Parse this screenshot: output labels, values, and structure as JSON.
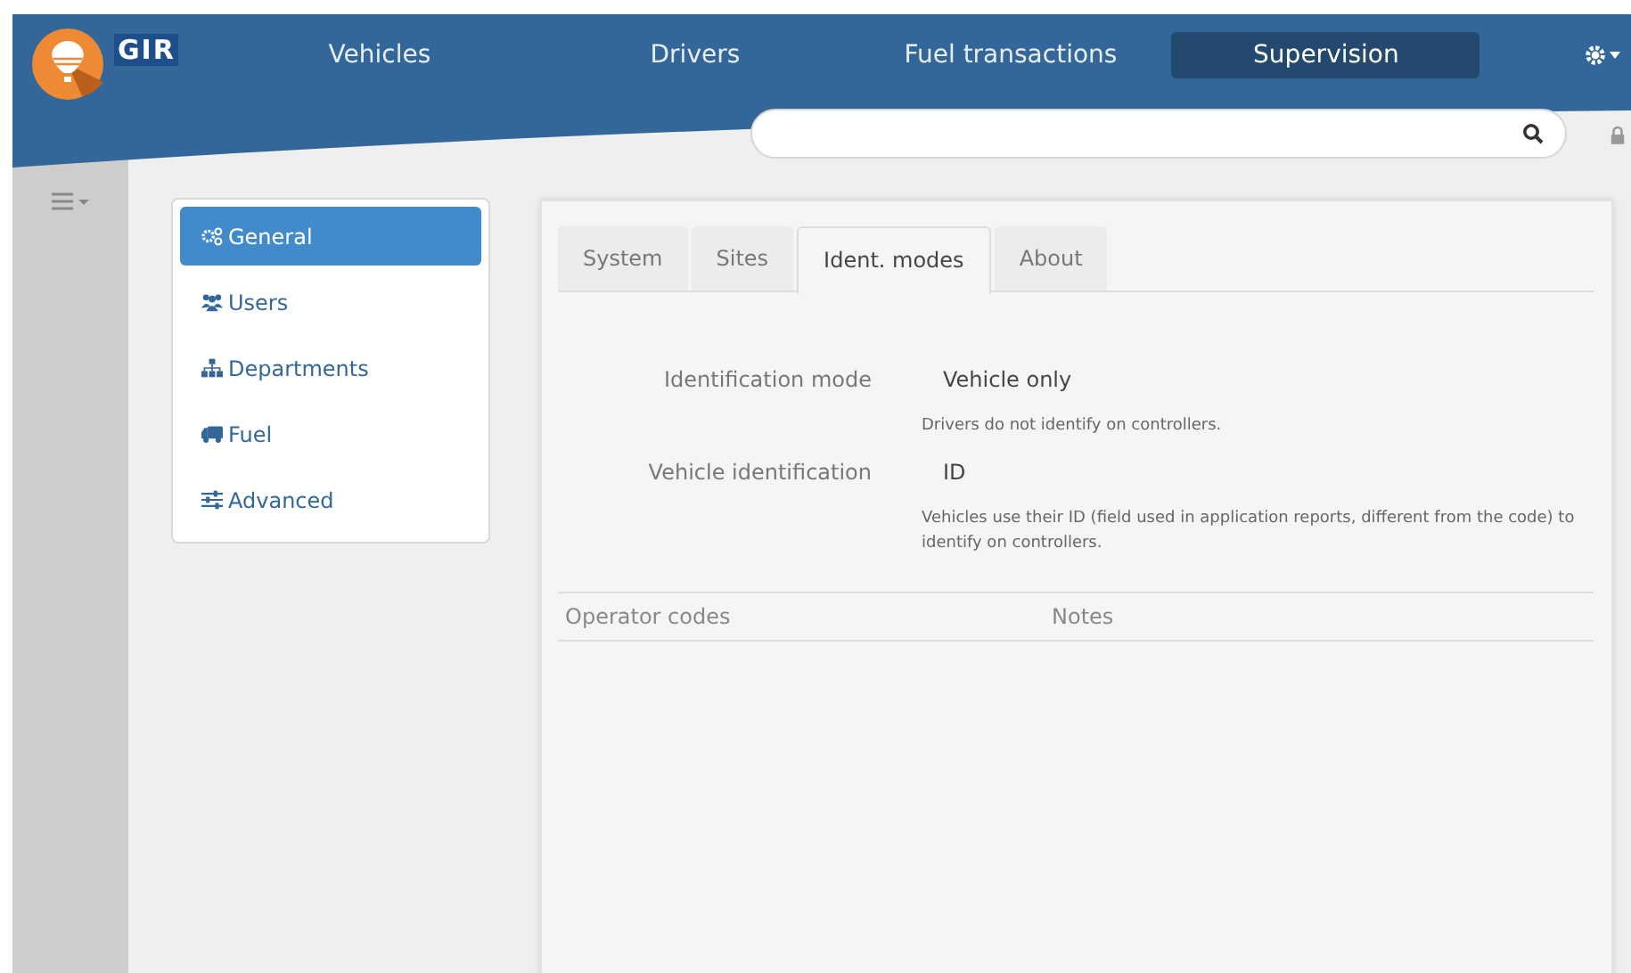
{
  "logo": {
    "text": "GIR"
  },
  "nav": [
    {
      "label": "Vehicles",
      "selected": false
    },
    {
      "label": "Drivers",
      "selected": false
    },
    {
      "label": "Fuel transactions",
      "selected": false
    },
    {
      "label": "Supervision",
      "selected": true
    }
  ],
  "menu": [
    {
      "label": "General",
      "selected": true
    },
    {
      "label": "Users",
      "selected": false
    },
    {
      "label": "Departments",
      "selected": false
    },
    {
      "label": "Fuel",
      "selected": false
    },
    {
      "label": "Advanced",
      "selected": false
    }
  ],
  "tabs": [
    {
      "label": "System",
      "selected": false
    },
    {
      "label": "Sites",
      "selected": false
    },
    {
      "label": "Ident. modes",
      "selected": true
    },
    {
      "label": "About",
      "selected": false
    }
  ],
  "fields": [
    {
      "label": "Identification mode",
      "value": "Vehicle only",
      "note": "Drivers do not identify on controllers."
    },
    {
      "label": "Vehicle identification",
      "value": "ID",
      "note": "Vehicles use their ID (field used in application reports, different from the code) to identify on controllers."
    }
  ],
  "table": {
    "columns": [
      "Operator codes",
      "Notes"
    ]
  }
}
